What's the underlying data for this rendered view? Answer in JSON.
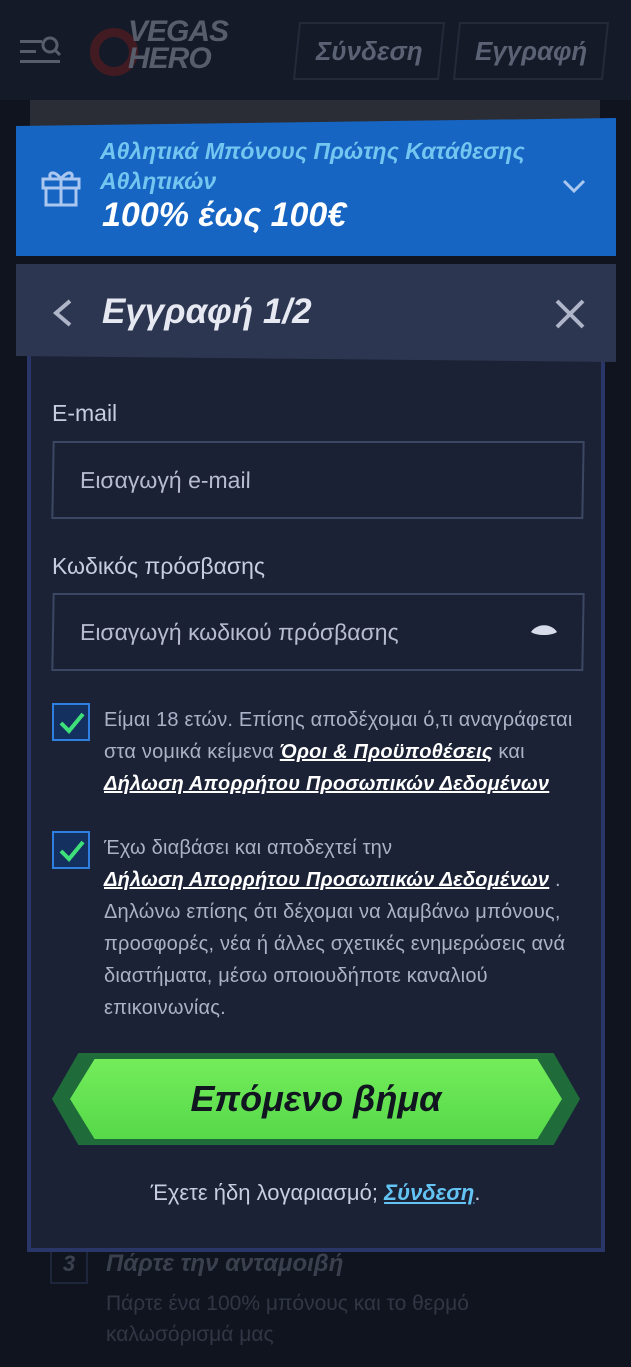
{
  "header": {
    "logo_text_line1": "VEGAS",
    "logo_text_line2": "HERO",
    "login_label": "Σύνδεση",
    "register_label": "Εγγραφή"
  },
  "background_step": {
    "number": "3",
    "title": "Πάρτε την ανταμοιβή",
    "description": "Πάρτε ένα 100% μπόνους και το θερμό καλωσόρισμά μας"
  },
  "promo": {
    "icon": "gift-icon",
    "title": "Αθλητικά Μπόνους Πρώτης Κατάθεσης Αθλητικών",
    "amount": "100% έως 100€",
    "expand_icon": "chevron-down-icon"
  },
  "modal": {
    "title": "Εγγραφή 1/2",
    "back_icon": "chevron-left-icon",
    "close_icon": "close-icon"
  },
  "form": {
    "email_label": "E-mail",
    "email_placeholder": "Εισαγωγή e-mail",
    "password_label": "Κωδικός πρόσβασης",
    "password_placeholder": "Εισαγωγή κωδικού πρόσβασης",
    "password_toggle_icon": "eye-icon"
  },
  "consents": {
    "age": {
      "checked": true,
      "text_before": "Είμαι 18 ετών. Επίσης αποδέχομαι ό,τι αναγράφεται στα νομικά κείμενα ",
      "link_terms": "Όροι & Προϋποθέσεις",
      "text_middle": " και ",
      "link_privacy": "Δήλωση Απορρήτου Προσωπικών Δεδομένων"
    },
    "marketing": {
      "checked": true,
      "text_before": "Έχω διαβάσει και αποδεχτεί την ",
      "link_privacy": "Δήλωση Απορρήτου Προσωπικών Δεδομένων",
      "text_after": " . Δηλώνω επίσης ότι δέχομαι να λαμβάνω μπόνους, προσφορές, νέα ή άλλες σχετικές ενημερώσεις ανά διαστήματα, μέσω οποιουδήποτε καναλιού επικοινωνίας."
    }
  },
  "next_button_label": "Επόμενο βήμα",
  "footer": {
    "have_account_text": "Έχετε ήδη λογαριασμό; ",
    "login_link": "Σύνδεση",
    "trailing": "."
  },
  "colors": {
    "promo_bg": "#1765c3",
    "next_button": "#63e24f",
    "link_accent": "#63c4f4",
    "checkbox_border": "#2f7fe0"
  }
}
